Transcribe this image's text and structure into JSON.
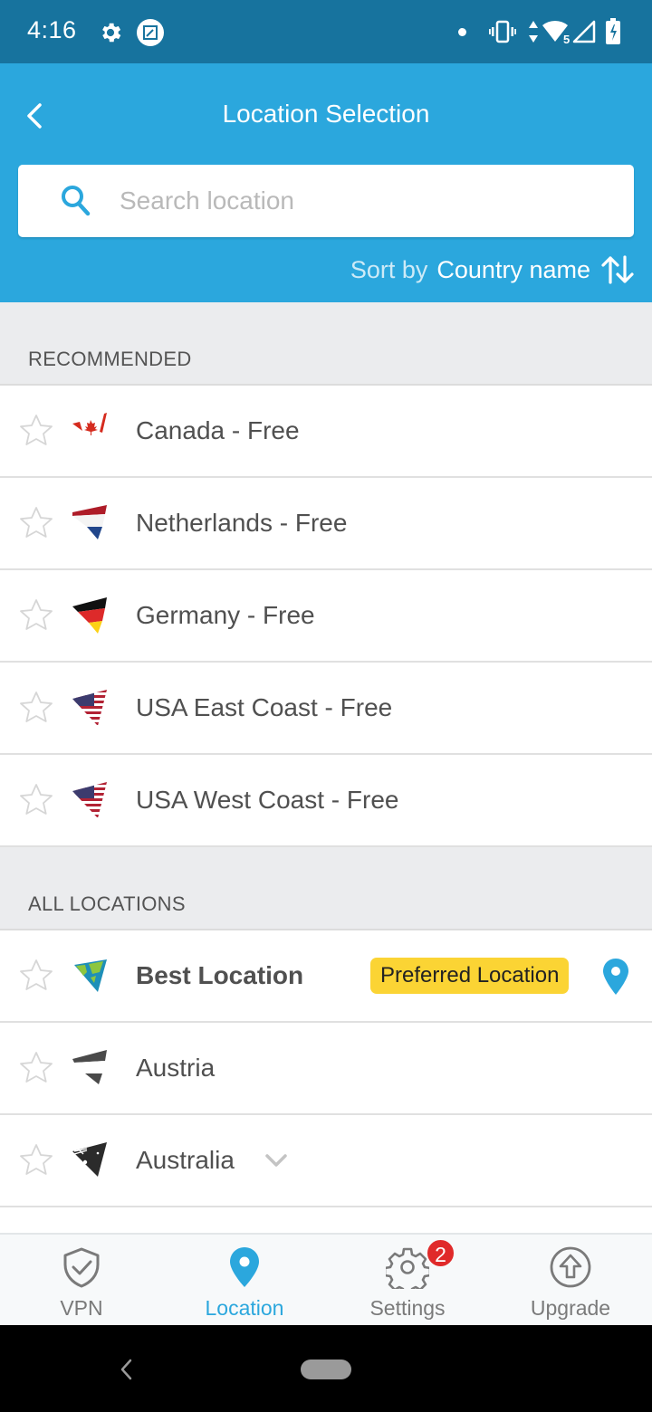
{
  "status_bar": {
    "time": "4:16",
    "icons": [
      "gear-icon",
      "screenshot-icon",
      "notification-dot",
      "vibrate-icon",
      "data-arrows-icon",
      "wifi-icon",
      "signal-icon",
      "battery-charging-icon"
    ],
    "wifi_label": "5"
  },
  "header": {
    "title": "Location Selection",
    "back_icon": "chevron-left-icon"
  },
  "search": {
    "placeholder": "Search location",
    "value": ""
  },
  "sort": {
    "label": "Sort by",
    "value": "Country name",
    "icon": "sort-arrows-icon"
  },
  "sections": [
    {
      "title": "RECOMMENDED",
      "items": [
        {
          "name": "Canada - Free",
          "flag": "canada",
          "favorite": false
        },
        {
          "name": "Netherlands - Free",
          "flag": "netherlands",
          "favorite": false
        },
        {
          "name": "Germany - Free",
          "flag": "germany",
          "favorite": false
        },
        {
          "name": "USA East Coast - Free",
          "flag": "usa",
          "favorite": false
        },
        {
          "name": "USA West Coast - Free",
          "flag": "usa",
          "favorite": false
        }
      ]
    },
    {
      "title": "ALL LOCATIONS",
      "items": [
        {
          "name": "Best Location",
          "flag": "globe",
          "favorite": false,
          "badge": "Preferred Location",
          "selected": true
        },
        {
          "name": "Austria",
          "flag": "austria",
          "favorite": false,
          "locked": true
        },
        {
          "name": "Australia",
          "flag": "australia",
          "favorite": false,
          "locked": true,
          "expandable": true
        }
      ]
    }
  ],
  "bottom_nav": {
    "items": [
      {
        "label": "VPN",
        "icon": "shield-check-icon",
        "active": false
      },
      {
        "label": "Location",
        "icon": "location-pin-icon",
        "active": true
      },
      {
        "label": "Settings",
        "icon": "gear-icon",
        "active": false,
        "badge": "2"
      },
      {
        "label": "Upgrade",
        "icon": "upgrade-arrow-icon",
        "active": false
      }
    ]
  },
  "colors": {
    "status_bar": "#17739e",
    "header": "#2ba7dd",
    "accent": "#2ba7dd",
    "badge_yellow": "#fbd434",
    "notification_red": "#e02a2a",
    "section_bg": "#ebecee"
  }
}
